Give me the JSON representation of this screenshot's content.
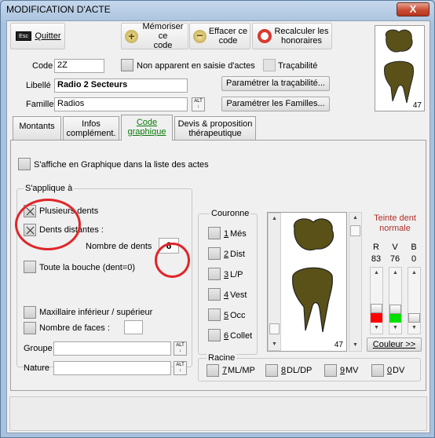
{
  "window": {
    "title": "MODIFICATION D'ACTE",
    "close_glyph": "X"
  },
  "toolbar": {
    "quit_icon": "Esc",
    "quit_label": "Quitter",
    "save_line1": "Mémoriser ce",
    "save_line2": "code",
    "erase_line1": "Effacer ce",
    "erase_line2": "code",
    "recalc_line1": "Recalculer les",
    "recalc_line2": "honoraires"
  },
  "form": {
    "code_label": "Code",
    "code_value": "2Z",
    "non_apparent_label": "Non apparent en saisie d'actes",
    "tracabilite_label": "Traçabilité",
    "libelle_label": "Libellé",
    "libelle_value": "Radio 2 Secteurs",
    "param_trac_label": "Paramétrer la traçabilité...",
    "famille_label": "Famille",
    "famille_value": "Radios",
    "param_fam_label": "Paramétrer les Familles...",
    "alt_label": "ALT"
  },
  "preview": {
    "tooth_number": "47"
  },
  "tabs": {
    "montants": "Montants",
    "infos_1": "Infos",
    "infos_2": "complément.",
    "code_1": "Code",
    "code_2": "graphique",
    "devis_1": "Devis & proposition",
    "devis_2": "thérapeutique"
  },
  "panel": {
    "affiche_label": "S'affiche en Graphique dans la liste des actes",
    "applique_title": "S'applique à",
    "plusieurs_label": "Plusieurs dents",
    "dents_dist_label": "Dents distantes :",
    "nombre_label": "Nombre de dents",
    "nombre_value": "6",
    "toute_label": "Toute la bouche (dent=0)",
    "maxillaire_label": "Maxillaire inférieur / supérieur",
    "faces_label": "Nombre de faces :",
    "groupe_label": "Groupe",
    "nature_label": "Nature"
  },
  "couronne": {
    "title": "Couronne",
    "items": [
      {
        "num": "1",
        "label": "Més"
      },
      {
        "num": "2",
        "label": "Dist"
      },
      {
        "num": "3",
        "label": "L/P"
      },
      {
        "num": "4",
        "label": "Vest"
      },
      {
        "num": "5",
        "label": "Occ"
      },
      {
        "num": "6",
        "label": "Collet"
      }
    ]
  },
  "tooth_view": {
    "number": "47"
  },
  "color_panel": {
    "title_1": "Teinte dent",
    "title_2": "normale",
    "r_label": "R",
    "v_label": "V",
    "b_label": "B",
    "r_value": "83",
    "v_value": "76",
    "b_value": "0",
    "r_color": "#ff0000",
    "v_color": "#00e000",
    "b_color": "#0000ff",
    "couleur_label": "Couleur >>"
  },
  "racine": {
    "title": "Racine",
    "items": [
      {
        "num": "7",
        "label": "ML/MP"
      },
      {
        "num": "8",
        "label": "DL/DP"
      },
      {
        "num": "9",
        "label": "MV"
      },
      {
        "num": "0",
        "label": "DV"
      }
    ]
  }
}
